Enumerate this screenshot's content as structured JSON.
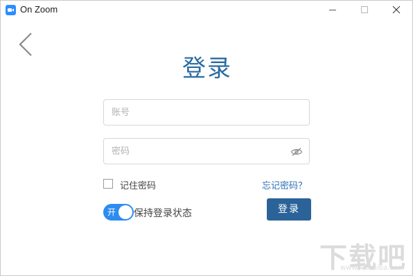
{
  "window": {
    "title": "On Zoom",
    "minimize_icon": "minimize-icon",
    "maximize_icon": "maximize-icon",
    "close_icon": "close-icon"
  },
  "nav": {
    "back_icon": "chevron-left-icon"
  },
  "login": {
    "heading": "登录",
    "account_placeholder": "账号",
    "account_value": "",
    "password_placeholder": "密码",
    "password_value": "",
    "password_visibility_icon": "eye-slash-icon",
    "remember_label": "记住密码",
    "remember_checked": false,
    "forgot_label": "忘记密码？",
    "keep_toggle_text": "开",
    "keep_toggle_on": true,
    "keep_label": "保持登录状态",
    "submit_label": "登录"
  },
  "watermark": {
    "text": "下载吧",
    "sub": "www.xiazaiba.com"
  },
  "colors": {
    "heading": "#2b6ca0",
    "submit_bg": "#2b6399",
    "toggle_bg": "#2d8cf0",
    "link": "#2d6fb6",
    "app_icon": "#2d8cff"
  }
}
